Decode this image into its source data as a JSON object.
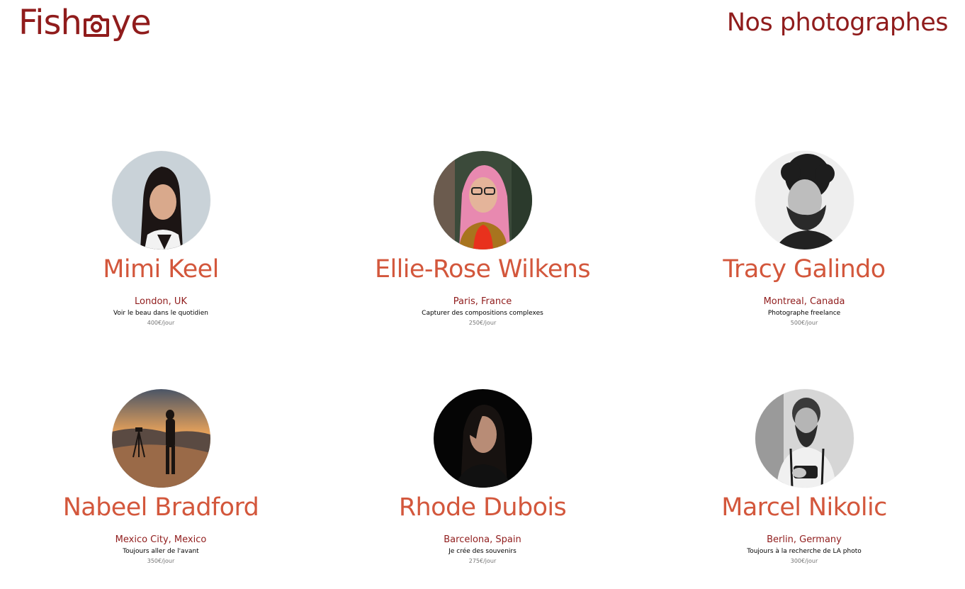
{
  "header": {
    "logo_text_left": "Fish",
    "logo_text_right": "ye",
    "title": "Nos photographes"
  },
  "colors": {
    "brand": "#901c1c",
    "accent": "#d3573c",
    "secondary_text": "#757575"
  },
  "photographers": [
    {
      "name": "Mimi Keel",
      "location": "London, UK",
      "tagline": "Voir le beau dans le quotidien",
      "price": "400€/jour"
    },
    {
      "name": "Ellie-Rose Wilkens",
      "location": "Paris, France",
      "tagline": "Capturer des compositions complexes",
      "price": "250€/jour"
    },
    {
      "name": "Tracy Galindo",
      "location": "Montreal, Canada",
      "tagline": "Photographe freelance",
      "price": "500€/jour"
    },
    {
      "name": "Nabeel Bradford",
      "location": "Mexico City, Mexico",
      "tagline": "Toujours aller de l'avant",
      "price": "350€/jour"
    },
    {
      "name": "Rhode Dubois",
      "location": "Barcelona, Spain",
      "tagline": "Je crée des souvenirs",
      "price": "275€/jour"
    },
    {
      "name": "Marcel Nikolic",
      "location": "Berlin, Germany",
      "tagline": "Toujours à la recherche de LA photo",
      "price": "300€/jour"
    }
  ]
}
